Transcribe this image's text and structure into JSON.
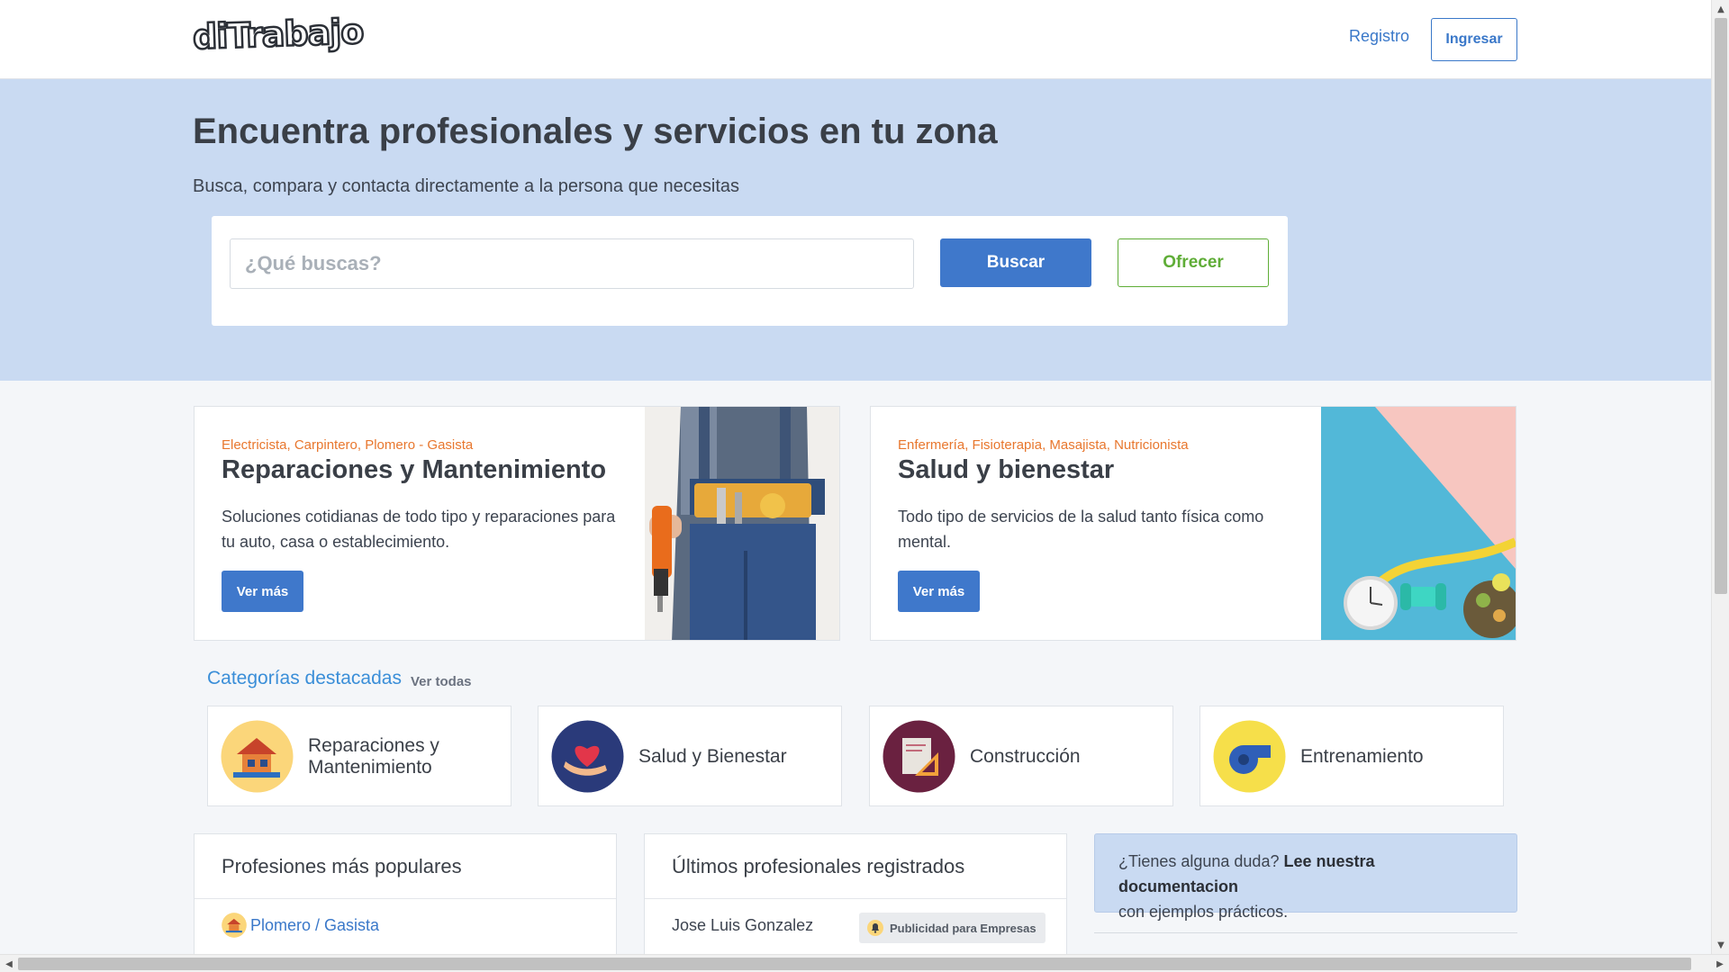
{
  "header": {
    "logo_text": "diTrabajo",
    "register_label": "Registro",
    "login_label": "Ingresar"
  },
  "hero": {
    "title": "Encuentra profesionales y servicios en tu zona",
    "subtitle": "Busca, compara y contacta directamente a la persona que necesitas",
    "search_placeholder": "¿Qué buscas?",
    "search_button": "Buscar",
    "offer_button": "Ofrecer"
  },
  "features": [
    {
      "tags": "Electricista, Carpintero, Plomero - Gasista",
      "title": "Reparaciones y Mantenimiento",
      "description": "Soluciones cotidianas de todo tipo y reparaciones para tu auto, casa o establecimiento.",
      "button": "Ver más",
      "image": "worker-with-drill"
    },
    {
      "tags": "Enfermería, Fisioterapia, Masajista, Nutricionista",
      "title": "Salud y bienestar",
      "description": "Todo tipo de servicios de la salud tanto física como mental.",
      "button": "Ver más",
      "image": "fitness-clock-dumbbells"
    }
  ],
  "categories": {
    "heading": "Categorías destacadas",
    "view_all": "Ver todas",
    "items": [
      {
        "label": "Reparaciones y Mantenimiento",
        "icon": "house-repair-icon",
        "color": "#fbd67a"
      },
      {
        "label": "Salud y Bienestar",
        "icon": "heart-hand-icon",
        "color": "#2a3a7a"
      },
      {
        "label": "Construcción",
        "icon": "blueprint-ruler-icon",
        "color": "#6a2140"
      },
      {
        "label": "Entrenamiento",
        "icon": "whistle-icon",
        "color": "#f6df4a"
      }
    ]
  },
  "panels": {
    "popular": {
      "title": "Profesiones más populares",
      "items": [
        {
          "label": "Plomero / Gasista",
          "icon": "house-repair-icon"
        }
      ]
    },
    "latest": {
      "title": "Últimos profesionales registrados",
      "items": [
        {
          "name": "Jose Luis Gonzalez"
        }
      ],
      "promo_badge": "Publicidad para Empresas"
    },
    "info": {
      "question": "¿Tienes alguna duda?",
      "link": "Lee nuestra documentacion",
      "rest": "con ejemplos prácticos."
    }
  },
  "colors": {
    "primary": "#3f78cb",
    "offer_green": "#5fad37",
    "hero_bg": "#c9daf2",
    "accent_orange": "#e8772e",
    "heading_blue": "#3a8ed8"
  }
}
